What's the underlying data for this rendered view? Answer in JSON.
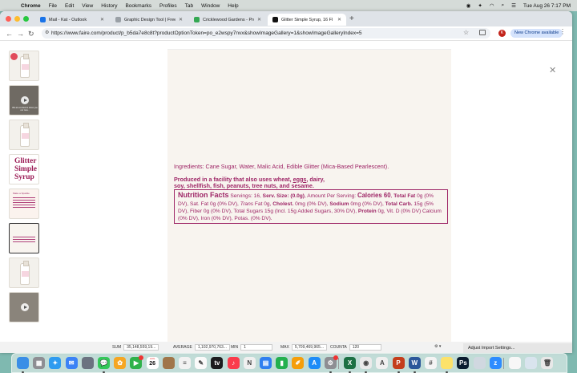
{
  "menubar": {
    "apple": "",
    "items": [
      "Chrome",
      "File",
      "Edit",
      "View",
      "History",
      "Bookmarks",
      "Profiles",
      "Tab",
      "Window",
      "Help"
    ],
    "clock": "Tue Aug 26  7:17 PM"
  },
  "tabs": [
    {
      "title": "Mail - Kat - Outlook",
      "favicon_color": "#1a73e8"
    },
    {
      "title": "Graphic Design Tool | Free O",
      "favicon_color": "#9aa0a6"
    },
    {
      "title": "Cricklewood Gardens - Produ",
      "favicon_color": "#34a853"
    },
    {
      "title": "Glitter Simple Syrup, 16 Fl o",
      "favicon_color": "#111111"
    }
  ],
  "toolbar": {
    "url": "https://www.faire.com/product/p_b5da7e8c8t?productOptionToken=po_e2wspy7nvx&showImageGallery=1&showImageGalleryIndex=5",
    "profile_initial": "K",
    "new_chrome": "New Chrome available"
  },
  "gallery": {
    "thumbnails": [
      {
        "kind": "bottle",
        "badge": true
      },
      {
        "kind": "video",
        "caption": "We are excited to show you our new..."
      },
      {
        "kind": "bottle",
        "badge": false
      },
      {
        "kind": "logo",
        "text": "Glitter Simple Syrup"
      },
      {
        "kind": "recipe",
        "text": "Make a Sparkle"
      },
      {
        "kind": "label",
        "selected": true
      },
      {
        "kind": "bottle",
        "badge": false
      },
      {
        "kind": "video",
        "caption": ""
      }
    ],
    "selected_index": 5
  },
  "label": {
    "ingredients": "Ingredients: Cane Sugar, Water, Malic Acid, Edible Glitter (Mica-Based Pearlescent).",
    "facility_pre": "Produced in a facility that also uses wheat, ",
    "facility_eggs": "eggs",
    "facility_post": ", dairy,",
    "facility_line2": "soy, shellfish, fish, peanuts, tree nuts, and sesame.",
    "nf_title": "Nutrition Facts",
    "servings": " Servings: 16, ",
    "serv_size_label": "Serv. Size: ",
    "serv_size": "(0.0g)",
    "amount": ", Amount Per Serving: ",
    "calories": "Calories 60",
    "comma": ",",
    "total_fat_label": "Total Fat",
    "total_fat": " 0g (0% DV), Sat. Fat 0g (0% DV), ",
    "trans_label": "Trans",
    "trans": " Fat 0g, ",
    "cholest_label": "Cholest.",
    "cholest": " 0mg (0% DV), ",
    "sodium_label": "Sodium",
    "sodium": " 0mg (0% DV), ",
    "carb_label": "Total Carb.",
    "carb": " 15g (5% DV), Fiber 0g (0% DV), Total Sugars 15g (Incl. 15g Added Sugars, 30% DV), ",
    "protein_label": "Protein",
    "protein": " 0g, Vit. D (0% DV) Calcium (0% DV), Iron (0% DV), Potas. (0% DV)."
  },
  "sheetbar": {
    "sum_label": "SUM",
    "sum": "35,148,559,19...",
    "avg_label": "AVERAGE",
    "avg": "1,102,970,763...",
    "min_label": "MIN",
    "min": "1",
    "max_label": "MAX",
    "max": "5,709,469,965...",
    "count_label": "COUNTA",
    "count": "120"
  },
  "adjust_import": "Adjust Import Settings...",
  "dock": {
    "calendar_month": "AUG",
    "calendar_day": "26",
    "apps": [
      {
        "name": "finder-icon",
        "color": "#3a8ee6",
        "glyph": ""
      },
      {
        "name": "launchpad-icon",
        "color": "#8e8e93",
        "glyph": "▦"
      },
      {
        "name": "safari-icon",
        "color": "#2e9bf0",
        "glyph": "✦"
      },
      {
        "name": "mail-icon",
        "color": "#3b82f6",
        "glyph": "✉"
      },
      {
        "name": "facetime-contacts-icon",
        "color": "#6b7280",
        "glyph": ""
      },
      {
        "name": "messages-icon",
        "color": "#34c759",
        "glyph": "💬"
      },
      {
        "name": "photos-icon",
        "color": "#f5a623",
        "glyph": "✿"
      },
      {
        "name": "facetime-icon",
        "color": "#2fb24a",
        "glyph": "▶"
      },
      {
        "name": "calendar-icon",
        "color": "#ffffff",
        "glyph": ""
      },
      {
        "name": "notes-archive-icon",
        "color": "#a0764a",
        "glyph": ""
      },
      {
        "name": "reminders-icon",
        "color": "#f2f2f2",
        "glyph": "≡"
      },
      {
        "name": "freeform-icon",
        "color": "#fafafa",
        "glyph": "✎"
      },
      {
        "name": "appletv-icon",
        "color": "#1c1c1e",
        "glyph": "tv"
      },
      {
        "name": "music-icon",
        "color": "#fa3c4c",
        "glyph": "♪"
      },
      {
        "name": "news-icon",
        "color": "#f0f0f0",
        "glyph": "N"
      },
      {
        "name": "keynote-icon",
        "color": "#2f7ff0",
        "glyph": "▤"
      },
      {
        "name": "numbers-icon",
        "color": "#24b04f",
        "glyph": "▮"
      },
      {
        "name": "pages-icon",
        "color": "#f59e0b",
        "glyph": "✐"
      },
      {
        "name": "appstore-icon",
        "color": "#1d8cf8",
        "glyph": "A"
      },
      {
        "name": "settings-icon",
        "color": "#8e8e93",
        "glyph": "⚙"
      },
      {
        "name": "excel-icon",
        "color": "#1d7044",
        "glyph": "X"
      },
      {
        "name": "chrome-icon",
        "color": "#eaeaea",
        "glyph": "◉"
      },
      {
        "name": "acrobat-icon",
        "color": "#f0f0f0",
        "glyph": "A"
      },
      {
        "name": "powerpoint-icon",
        "color": "#c43e1c",
        "glyph": "P"
      },
      {
        "name": "word-icon",
        "color": "#2b579a",
        "glyph": "W"
      },
      {
        "name": "slack-icon",
        "color": "#f4f4f4",
        "glyph": "#"
      },
      {
        "name": "notes-icon",
        "color": "#fce26a",
        "glyph": ""
      },
      {
        "name": "photoshop-icon",
        "color": "#0a1c2f",
        "glyph": "Ps"
      },
      {
        "name": "preview-icon",
        "color": "#d0d8e0",
        "glyph": ""
      },
      {
        "name": "zoom-icon",
        "color": "#2d8cff",
        "glyph": "z"
      },
      {
        "name": "textedit-icon",
        "color": "#f7f7f7",
        "glyph": ""
      },
      {
        "name": "folder-icon",
        "color": "#d9e4ee",
        "glyph": ""
      },
      {
        "name": "trash-icon",
        "color": "#e8e8e8",
        "glyph": "🗑"
      }
    ]
  }
}
